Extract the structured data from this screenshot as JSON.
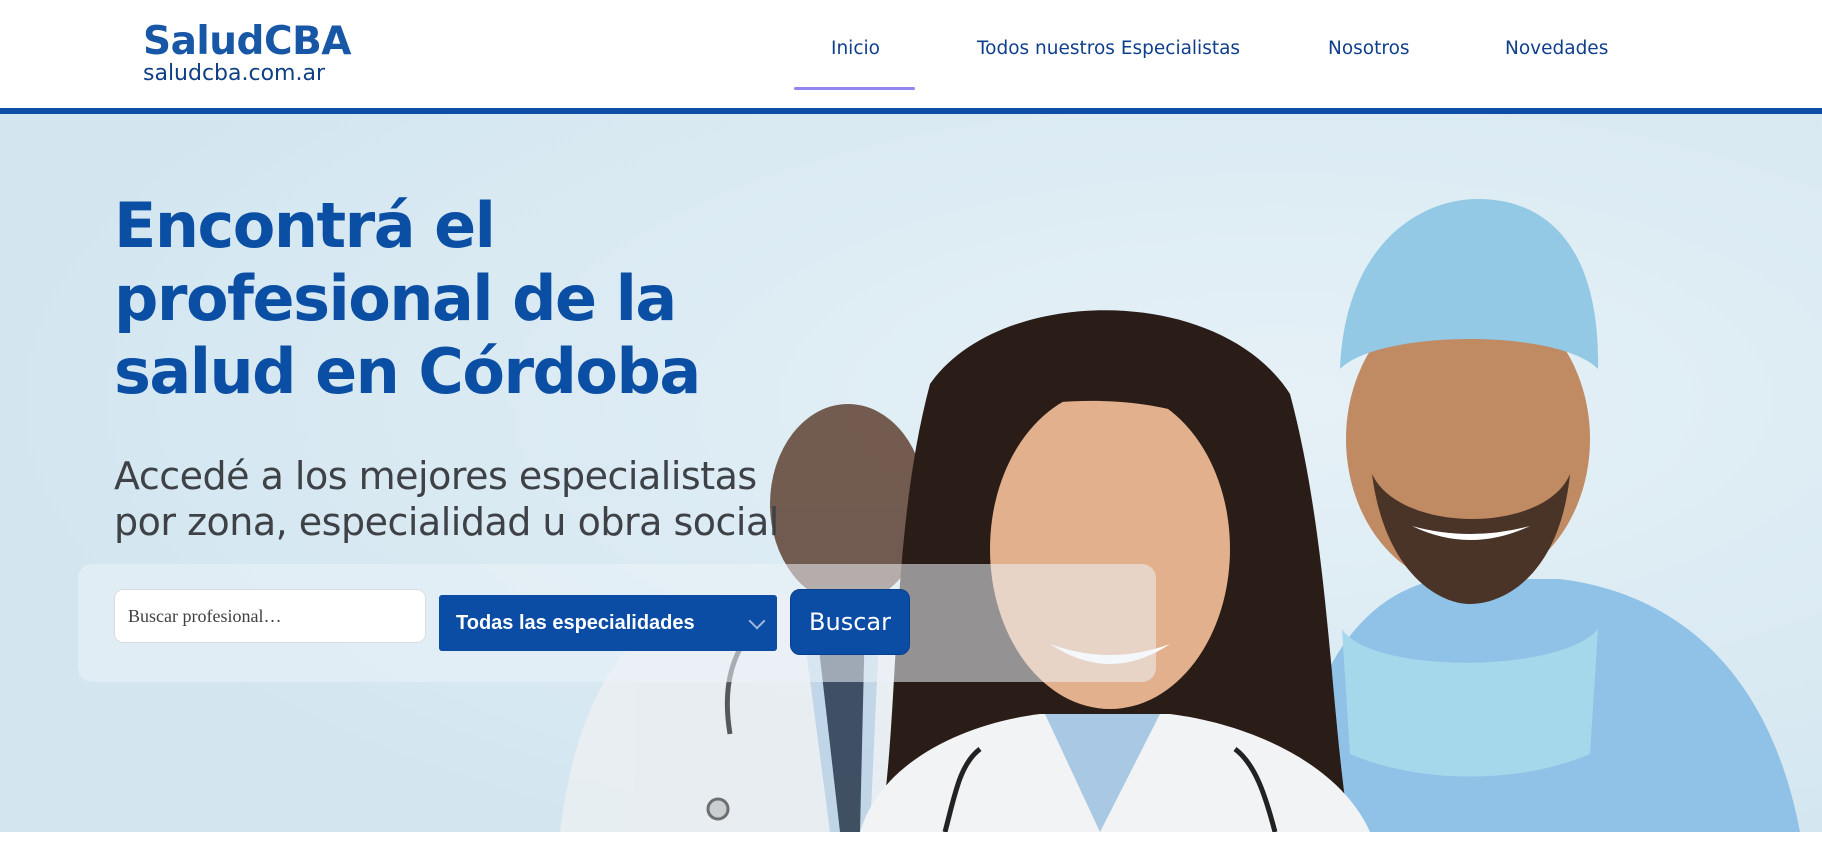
{
  "header": {
    "logo_brand": "SaludCBA",
    "logo_domain": "saludcba.com.ar",
    "nav": [
      {
        "label": "Inicio",
        "active": true
      },
      {
        "label": "Todos nuestros Especialistas",
        "active": false
      },
      {
        "label": "Nosotros",
        "active": false
      },
      {
        "label": "Novedades",
        "active": false
      }
    ]
  },
  "hero": {
    "headline_line1": "Encontrá el",
    "headline_line2": "profesional de la",
    "headline_line3": "salud en Córdoba",
    "subline_line1": "Accedé a los mejores especialistas",
    "subline_line2": "por zona, especialidad u obra social"
  },
  "search": {
    "placeholder": "Buscar profesional…",
    "specialty_selected": "Todas las especialidades",
    "button_label": "Buscar"
  },
  "colors": {
    "brand_blue": "#0b4ca4",
    "hero_background": "#dbebf3",
    "active_underline": "#8f86ef"
  }
}
